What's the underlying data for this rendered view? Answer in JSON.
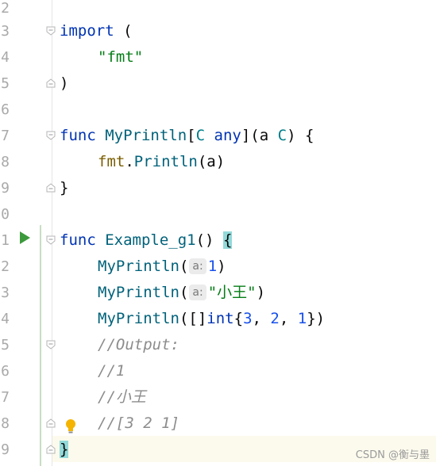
{
  "editor": {
    "lines": [
      {
        "num": "2"
      },
      {
        "num": "3"
      },
      {
        "num": "4"
      },
      {
        "num": "5"
      },
      {
        "num": "6"
      },
      {
        "num": "7"
      },
      {
        "num": "8"
      },
      {
        "num": "9"
      },
      {
        "num": "0"
      },
      {
        "num": "1"
      },
      {
        "num": "2"
      },
      {
        "num": "3"
      },
      {
        "num": "4"
      },
      {
        "num": "5"
      },
      {
        "num": "6"
      },
      {
        "num": "7"
      },
      {
        "num": "8"
      },
      {
        "num": "9"
      }
    ],
    "code": {
      "l3_kw": "import",
      "l3_rest": " (",
      "l4_str": "\"fmt\"",
      "l5": ")",
      "l7_kw": "func",
      "l7_name": "MyPrintln",
      "l7_b1": "[",
      "l7_tp1": "C",
      "l7_sp": " ",
      "l7_any": "any",
      "l7_rest": "](a ",
      "l7_tp2": "C",
      "l7_end": ") {",
      "l8_pkg": "fmt",
      "l8_dot": ".",
      "l8_fn": "Println",
      "l8_rest": "(a)",
      "l9": "}",
      "l11_kw": "func",
      "l11_name": "Example_g1",
      "l11_paren": "() ",
      "l11_brace": "{",
      "l12_fn": "MyPrintln",
      "l12_open": "(",
      "l12_hint": "a:",
      "l12_num": "1",
      "l12_close": ")",
      "l13_fn": "MyPrintln",
      "l13_open": "(",
      "l13_hint": "a:",
      "l13_str": "\"小王\"",
      "l13_close": ")",
      "l14_fn": "MyPrintln",
      "l14_open": "([]",
      "l14_kw": "int",
      "l14_b": "{",
      "l14_n1": "3",
      "l14_c1": ", ",
      "l14_n2": "2",
      "l14_c2": ", ",
      "l14_n3": "1",
      "l14_end": "})",
      "l15_cmt": "//Output:",
      "l16_cmt": "//1",
      "l17_cmt": "//小王",
      "l18_cmt": "//[3 2 1]",
      "l19_brace": "}"
    }
  },
  "icons": {
    "run": "run-gutter-icon",
    "bulb": "lightbulb-icon",
    "fold": "fold-marker-icon"
  },
  "watermark": "CSDN @衡与墨"
}
